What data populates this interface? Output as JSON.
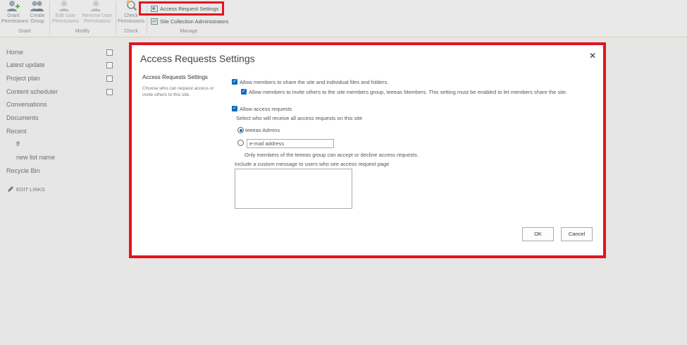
{
  "ribbon": {
    "grant_permissions": "Grant Permissions",
    "create_group": "Create Group",
    "edit_user_permissions": "Edit User Permissions",
    "remove_user_permissions": "Remove User Permissions",
    "check_permissions": "Check Permissions",
    "access_request_settings": "Access Request Settings",
    "site_collection_administrators": "Site Collection Administrators",
    "groups": {
      "grant": "Grant",
      "modify": "Modify",
      "check": "Check",
      "manage": "Manage"
    }
  },
  "nav": {
    "items": [
      "Home",
      "Latest update",
      "Project plan",
      "Content scheduler",
      "Conversations",
      "Documents",
      "Recent"
    ],
    "recent_items": [
      "ff",
      "new list name"
    ],
    "recycle_bin": "Recycle Bin",
    "edit_links": "EDIT LINKS"
  },
  "dialog": {
    "title": "Access Requests Settings",
    "close_glyph": "✕",
    "section_title": "Access Requests Settings",
    "section_desc": "Choose who can request access or invite others to this site.",
    "allow_share_label": "Allow members to share the site and individual files and folders.",
    "allow_invite_label": "Allow members to invite others to the site members group, teeeas Members. This setting must be enabled to let members share the site.",
    "allow_access_requests_label": "Allow access requests",
    "select_who_label": "Select who will receive all access requests on this site",
    "radio_admins_label": "teeeas Admins",
    "email_placeholder": "e-mail address",
    "only_members_note": "Only members of the teeeas group can accept or decline access requests.",
    "custom_message_label": "Include a custom message to users who see access request page",
    "ok_label": "OK",
    "cancel_label": "Cancel"
  },
  "colors": {
    "highlight": "#e3141e",
    "accent": "#0f6cbd"
  }
}
